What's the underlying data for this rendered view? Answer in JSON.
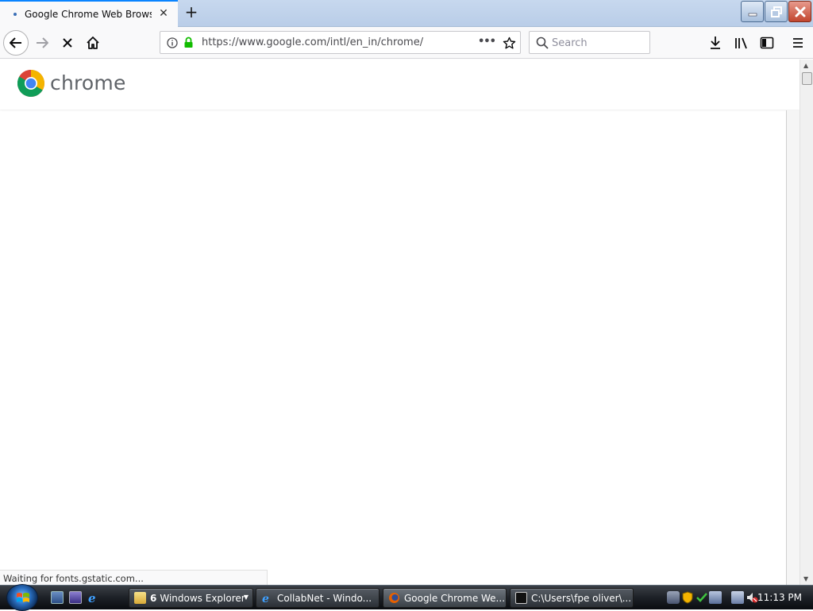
{
  "browser": {
    "tab": {
      "title": "Google Chrome Web Browser",
      "close_symbol": "✕"
    },
    "new_tab_symbol": "+",
    "window_buttons": {
      "minimize": "–",
      "restore": "❐",
      "close": "✕"
    },
    "nav": {
      "back_icon": "back-arrow-icon",
      "forward_icon": "forward-arrow-icon",
      "stop_icon": "stop-icon",
      "home_icon": "home-icon"
    },
    "urlbar": {
      "url": "https://www.google.com/intl/en_in/chrome/",
      "page_actions_symbol": "•••"
    },
    "search": {
      "placeholder": "Search"
    },
    "status_text": "Waiting for fonts.gstatic.com..."
  },
  "page": {
    "logo_text": "chrome"
  },
  "taskbar": {
    "items": [
      {
        "label": "6 Windows Explorer",
        "count": "6",
        "name": "Windows Explorer"
      },
      {
        "label": "CollabNet - Windo..."
      },
      {
        "label": "Google Chrome We..."
      },
      {
        "label": "C:\\Users\\fpe oliver\\..."
      }
    ],
    "clock": "11:13 PM"
  },
  "colors": {
    "accent": "#0a84ff",
    "chrome_red": "#db4437",
    "chrome_green": "#0f9d58",
    "chrome_yellow": "#f4b400",
    "chrome_blue": "#4285f4",
    "lock_green": "#12bc00"
  }
}
